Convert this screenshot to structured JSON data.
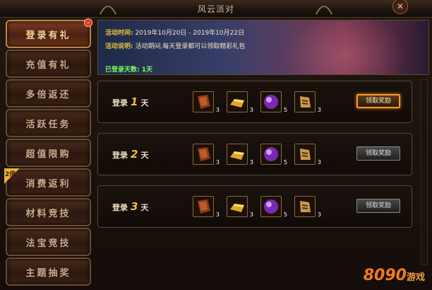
{
  "window": {
    "title": "风云派对"
  },
  "sidebar": {
    "items": [
      {
        "label": "登录有礼"
      },
      {
        "label": "充值有礼"
      },
      {
        "label": "多倍返还"
      },
      {
        "label": "活跃任务"
      },
      {
        "label": "超值限购"
      },
      {
        "label": "消费返利",
        "badge": "2倍"
      },
      {
        "label": "材料竞技"
      },
      {
        "label": "法宝竞技"
      },
      {
        "label": "主题抽奖"
      }
    ]
  },
  "banner": {
    "time_key": "活动时间:",
    "time_value": "2019年10月20日 - 2019年10月22日",
    "desc_key": "活动说明:",
    "desc_value": "活动期间,每天登录都可以领取精彩礼包",
    "days_label": "已登录天数: 1天"
  },
  "rows": [
    {
      "prefix": "登录",
      "day": "1",
      "suffix": "天",
      "counts": [
        "3",
        "3",
        "5",
        "3"
      ],
      "button": "领取奖励"
    },
    {
      "prefix": "登录",
      "day": "2",
      "suffix": "天",
      "counts": [
        "3",
        "3",
        "5",
        "3"
      ],
      "button": "领取奖励"
    },
    {
      "prefix": "登录",
      "day": "3",
      "suffix": "天",
      "counts": [
        "3",
        "3",
        "5",
        "3"
      ],
      "button": "领取奖励"
    }
  ],
  "watermark": {
    "text": "8090",
    "small": "游戏"
  },
  "colors": {
    "accent": "#f0c040",
    "active_border": "#f29a2a",
    "days_green": "#7aff5a"
  }
}
